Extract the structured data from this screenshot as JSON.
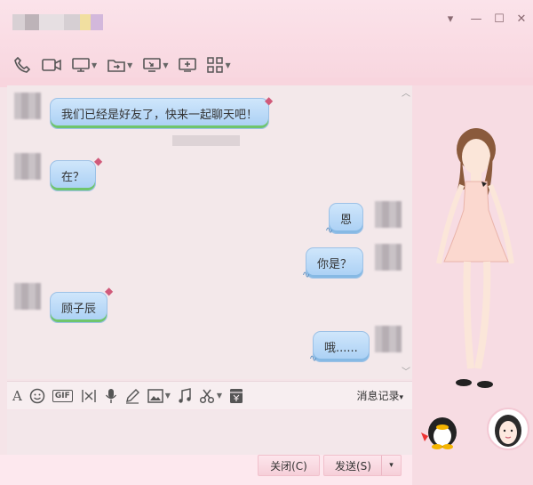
{
  "titlebar": {
    "window_controls": {
      "menu": "▾",
      "minimize": "—",
      "maximize": "☐",
      "close": "✕"
    }
  },
  "toolbar": {
    "icons": [
      "phone-icon",
      "video-icon",
      "screen-share-icon",
      "file-transfer-icon",
      "remote-desktop-icon",
      "add-icon",
      "apps-icon"
    ]
  },
  "messages": [
    {
      "side": "left",
      "text": "我们已经是好友了，快来一起聊天吧！"
    },
    {
      "side": "left",
      "text": "在？"
    },
    {
      "side": "right",
      "text": "恩"
    },
    {
      "side": "right",
      "text": "你是？"
    },
    {
      "side": "left",
      "text": "顾子辰"
    },
    {
      "side": "right",
      "text": "哦......"
    }
  ],
  "input_toolbar": {
    "gif_label": "GIF",
    "history_label": "消息记录",
    "history_caret": "▾"
  },
  "buttons": {
    "close_label": "关闭(C)",
    "send_label": "发送(S)",
    "send_caret": "▾"
  },
  "colors": {
    "accent_pink": "#f8d5de",
    "bubble_blue": "#a9cff4",
    "bubble_green_edge": "#6fc56c"
  }
}
